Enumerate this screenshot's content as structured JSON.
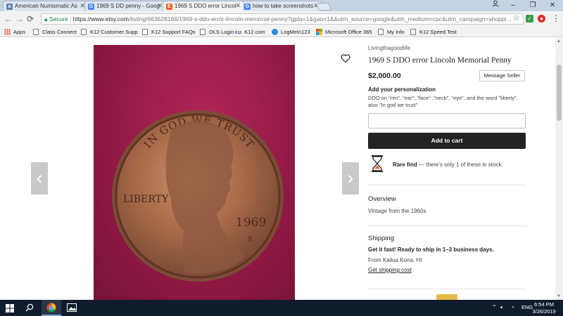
{
  "browser": {
    "tabs": [
      {
        "title": "American Numismatic As",
        "favicon": "ana-icon",
        "active": false
      },
      {
        "title": "1969 S DD penny - Goog",
        "favicon": "google-icon",
        "active": false
      },
      {
        "title": "1969 S DDO error Lincol",
        "favicon": "etsy-icon",
        "active": true
      },
      {
        "title": "how to take screenshots",
        "favicon": "google-icon",
        "active": false
      }
    ],
    "secure_label": "Secure",
    "url_host": "https://www.etsy.com",
    "url_path": "/listing/663628166/1969-s-ddo-error-lincoln-memorial-penny?gpla=1&gao=1&&utm_source=google&utm_medium=cpc&utm_campaign=shoppi...",
    "window_controls": {
      "minimize": "–",
      "maximize": "❐",
      "close": "✕"
    },
    "bookmarks": [
      "Apps",
      "Class Connect",
      "K12 Customer Supp",
      "K12 Support FAQs",
      "OLS Login",
      "K12.com",
      "LogMeIn123",
      "Microsoft Office 365",
      "My Info",
      "K12 Speed Test"
    ],
    "k12_badge": "K12"
  },
  "listing": {
    "shop_name": "Livingthagoodlife",
    "title": "1969 S DDO error Lincoln Memorial Penny",
    "price": "$2,000.00",
    "message_seller": "Message Seller",
    "personalization_label": "Add your personalization",
    "personalization_desc": "DDO on \"rim\", \"ear\", \"face\" ,\"neck\", \"eye\", and the word \"liberty\". also \"In god we trust\"",
    "add_to_cart": "Add to cart",
    "rare_find_bold": "Rare find",
    "rare_find_text": " — there's only 1 of these in stock.",
    "overview_heading": "Overview",
    "overview_text": "Vintage from the 1960s",
    "shipping_heading": "Shipping",
    "shipping_bold": "Get it fast! Ready to ship in 1–3 business days.",
    "shipping_from": "From Kailua Kona, HI",
    "shipping_cost_link": "Get shipping cost"
  },
  "coin": {
    "motto": "IN GOD WE TRUST",
    "liberty": "LIBERTY",
    "year": "1969",
    "mint": "S"
  },
  "taskbar": {
    "language": "ENG",
    "time": "6:54 PM",
    "date": "3/26/2019"
  },
  "colors": {
    "etsy_orange": "#f1641e",
    "photo_background": "#931a46",
    "add_to_cart_bg": "#222222",
    "taskbar": "#101c2c"
  }
}
